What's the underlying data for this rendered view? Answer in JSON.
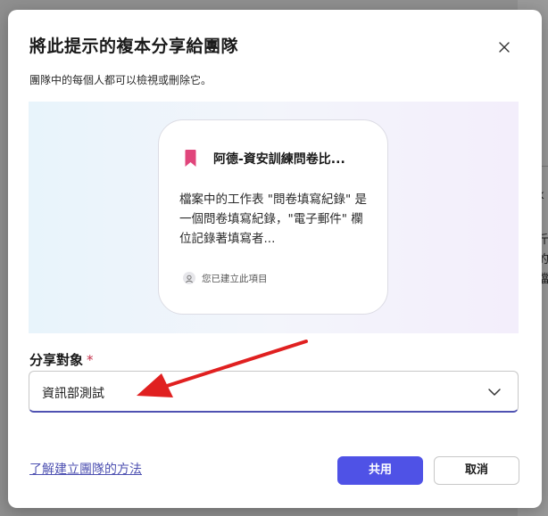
{
  "dialog": {
    "title": "將此提示的複本分享給團隊",
    "subtitle": "團隊中的每個人都可以檢視或刪除它。",
    "close_icon": "close-icon"
  },
  "preview_card": {
    "icon": "bookmark-icon",
    "icon_color": "#e0457b",
    "title": "阿德-資安訓練問卷比...",
    "body": "檔案中的工作表 \"問卷填寫紀錄\" 是一個問卷填寫紀錄，\"電子郵件\" 欄位記錄著填寫者...",
    "creator_icon": "person-icon",
    "creator_text": "您已建立此項目"
  },
  "share_target": {
    "label": "分享對象",
    "required_marker": "*",
    "selected_value": "資訊部測試",
    "chevron_icon": "chevron-down-icon"
  },
  "footer": {
    "learn_link": "了解建立團隊的方法",
    "share_button": "共用",
    "cancel_button": "取消"
  },
  "colors": {
    "accent": "#4f52e6",
    "annotation_arrow": "#e02020"
  },
  "background_app": {
    "visible_chars": [
      "k",
      "斤",
      "的",
      "檔"
    ]
  }
}
